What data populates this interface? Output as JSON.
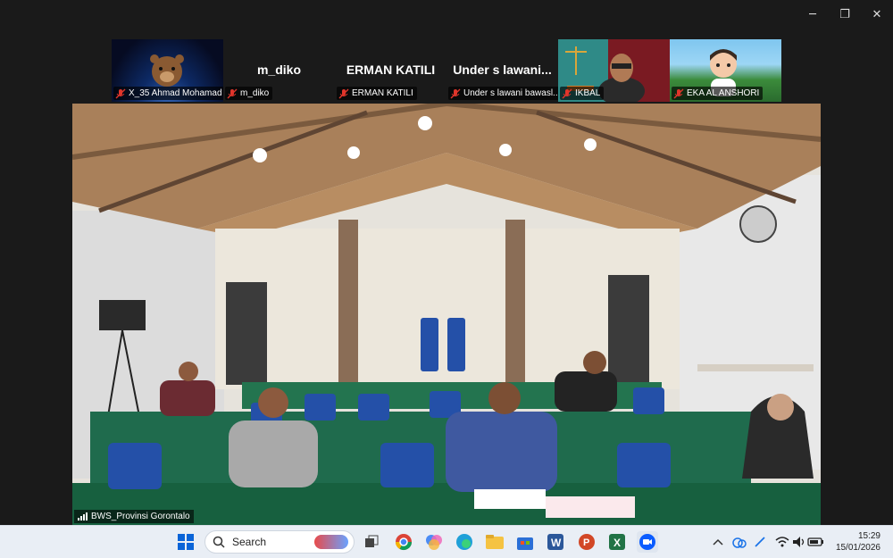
{
  "window": {
    "minimize_glyph": "─",
    "restore_glyph": "❐",
    "close_glyph": "✕"
  },
  "participants": [
    {
      "name": "X_35 Ahmad Mohamad",
      "display": "",
      "style": "space"
    },
    {
      "name": "m_diko",
      "display": "m_diko",
      "style": "dark"
    },
    {
      "name": "ERMAN KATILI",
      "display": "ERMAN KATILI",
      "style": "dark"
    },
    {
      "name": "Under s lawani bawasl...",
      "display": "Under s lawani...",
      "style": "dark"
    },
    {
      "name": "IKBAL",
      "display": "",
      "style": "law"
    },
    {
      "name": "EKA AL ANSHORI",
      "display": "",
      "style": "nature"
    }
  ],
  "main_video": {
    "speaker": "BWS_Provinsi Gorontalo"
  },
  "taskbar": {
    "search_placeholder": "Search",
    "apps": [
      "windows-start",
      "search",
      "task-view",
      "chrome",
      "copilot",
      "edge",
      "file-explorer",
      "store",
      "word",
      "powerpoint",
      "excel",
      "zoom"
    ],
    "time": "15:29",
    "date": "15/01/2026"
  },
  "colors": {
    "taskbar": "#e9eef5",
    "mute_red": "#e0352b",
    "zoom_blue": "#0b5cff"
  }
}
